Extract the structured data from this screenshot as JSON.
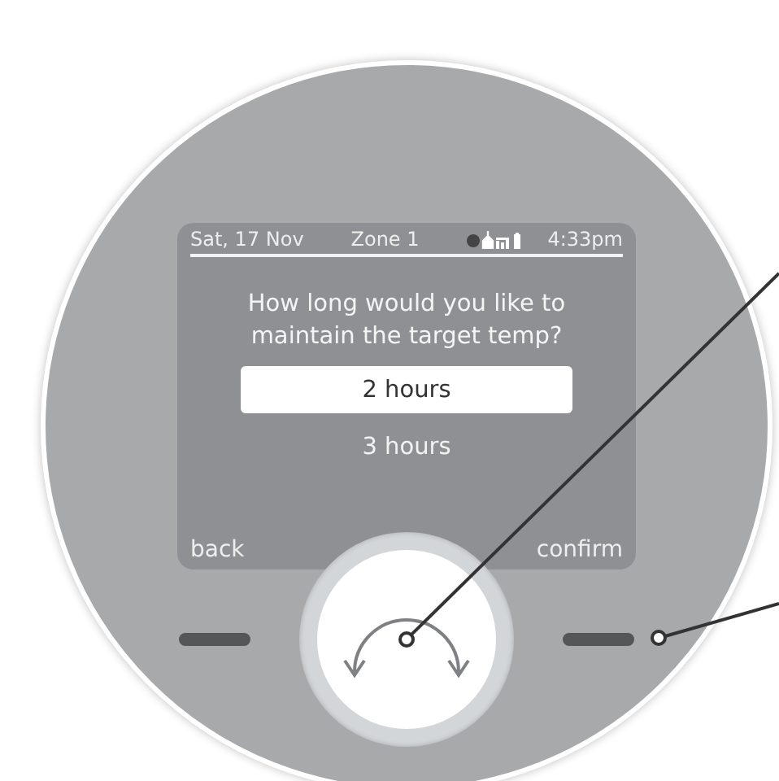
{
  "status_bar": {
    "date": "Sat, 17 Nov",
    "zone": "Zone 1",
    "time": "4:33pm"
  },
  "prompt": "How long would you like to maintain the target temp?",
  "options": [
    {
      "label": "2 hours",
      "selected": true
    },
    {
      "label": "3 hours",
      "selected": false
    }
  ],
  "soft_keys": {
    "left": "back",
    "right": "confirm"
  }
}
